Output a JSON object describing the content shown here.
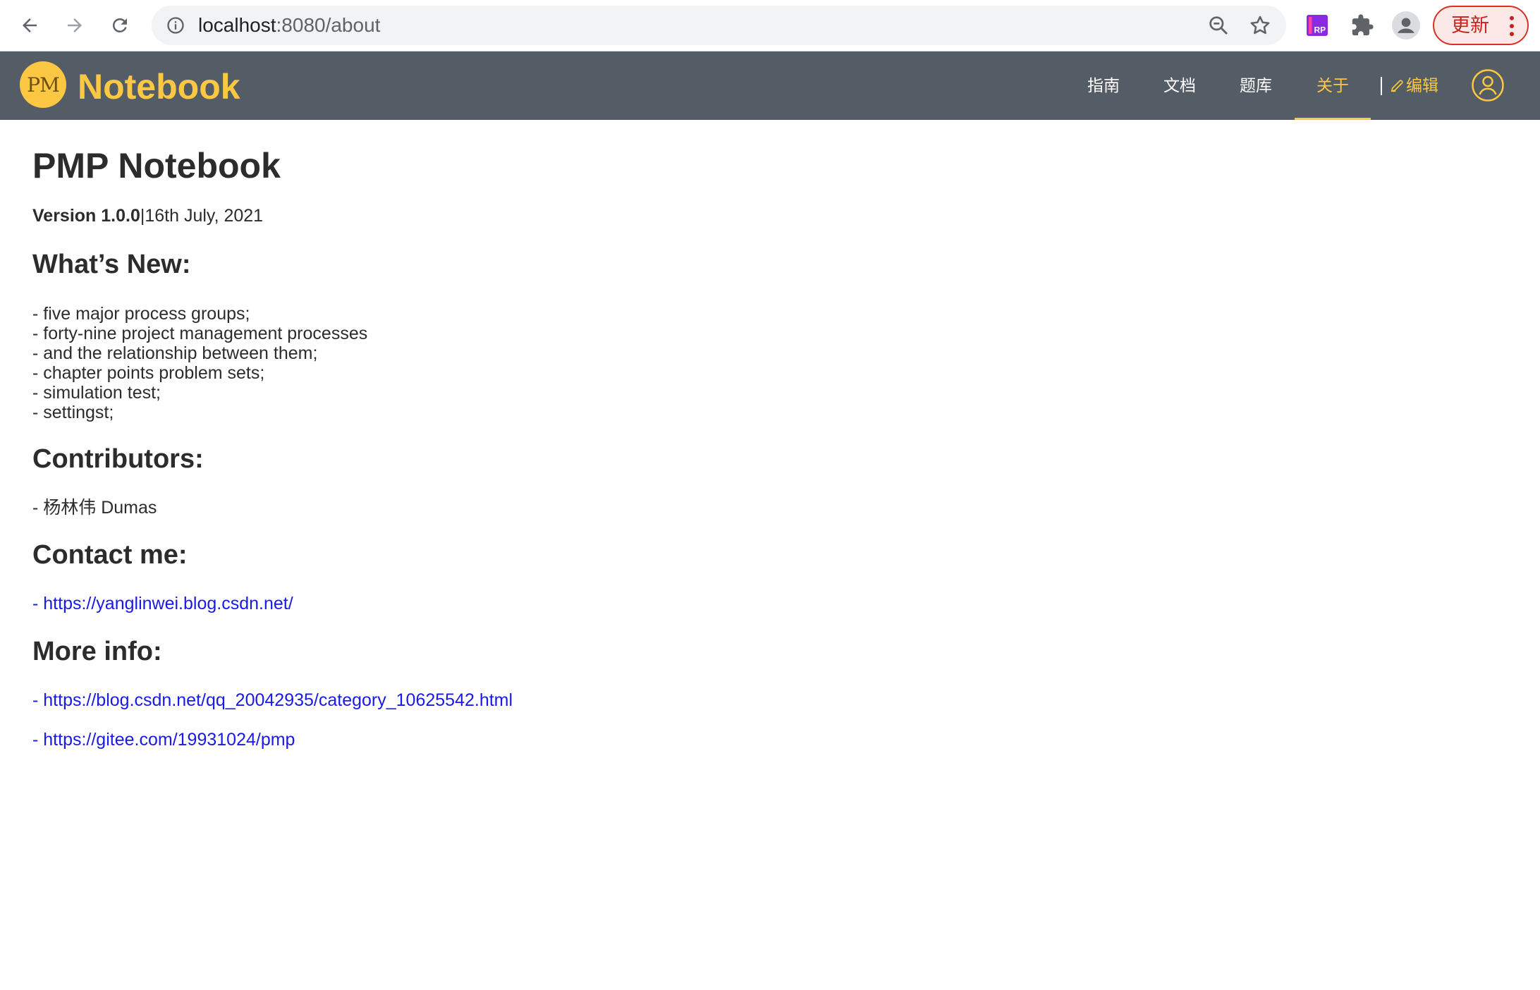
{
  "browser": {
    "url_host": "localhost",
    "url_path": ":8080/about",
    "update_label": "更新"
  },
  "header": {
    "logo_text": "PM",
    "brand": "Notebook",
    "nav": [
      {
        "label": "指南"
      },
      {
        "label": "文档"
      },
      {
        "label": "题库"
      },
      {
        "label": "关于"
      }
    ],
    "active_index": 3,
    "edit_label": "编辑",
    "accent_color": "#fcc742",
    "bar_color": "#545d66"
  },
  "page": {
    "title": "PMP Notebook",
    "version_label": "Version 1.0.0",
    "version_date": "16th July, 2021",
    "whats_new_heading": "What’s New:",
    "whats_new_items": [
      "- five major process groups;",
      "- forty-nine project management processes",
      "- and the relationship between them;",
      "- chapter points problem sets;",
      "- simulation test;",
      "- settingst;"
    ],
    "contributors_heading": "Contributors:",
    "contributors": [
      "- 杨林伟 Dumas"
    ],
    "contact_heading": "Contact me:",
    "contact_link": "- https://yanglinwei.blog.csdn.net/",
    "more_info_heading": "More info:",
    "more_info_links": [
      "- https://blog.csdn.net/qq_20042935/category_10625542.html",
      "- https://gitee.com/19931024/pmp"
    ]
  }
}
